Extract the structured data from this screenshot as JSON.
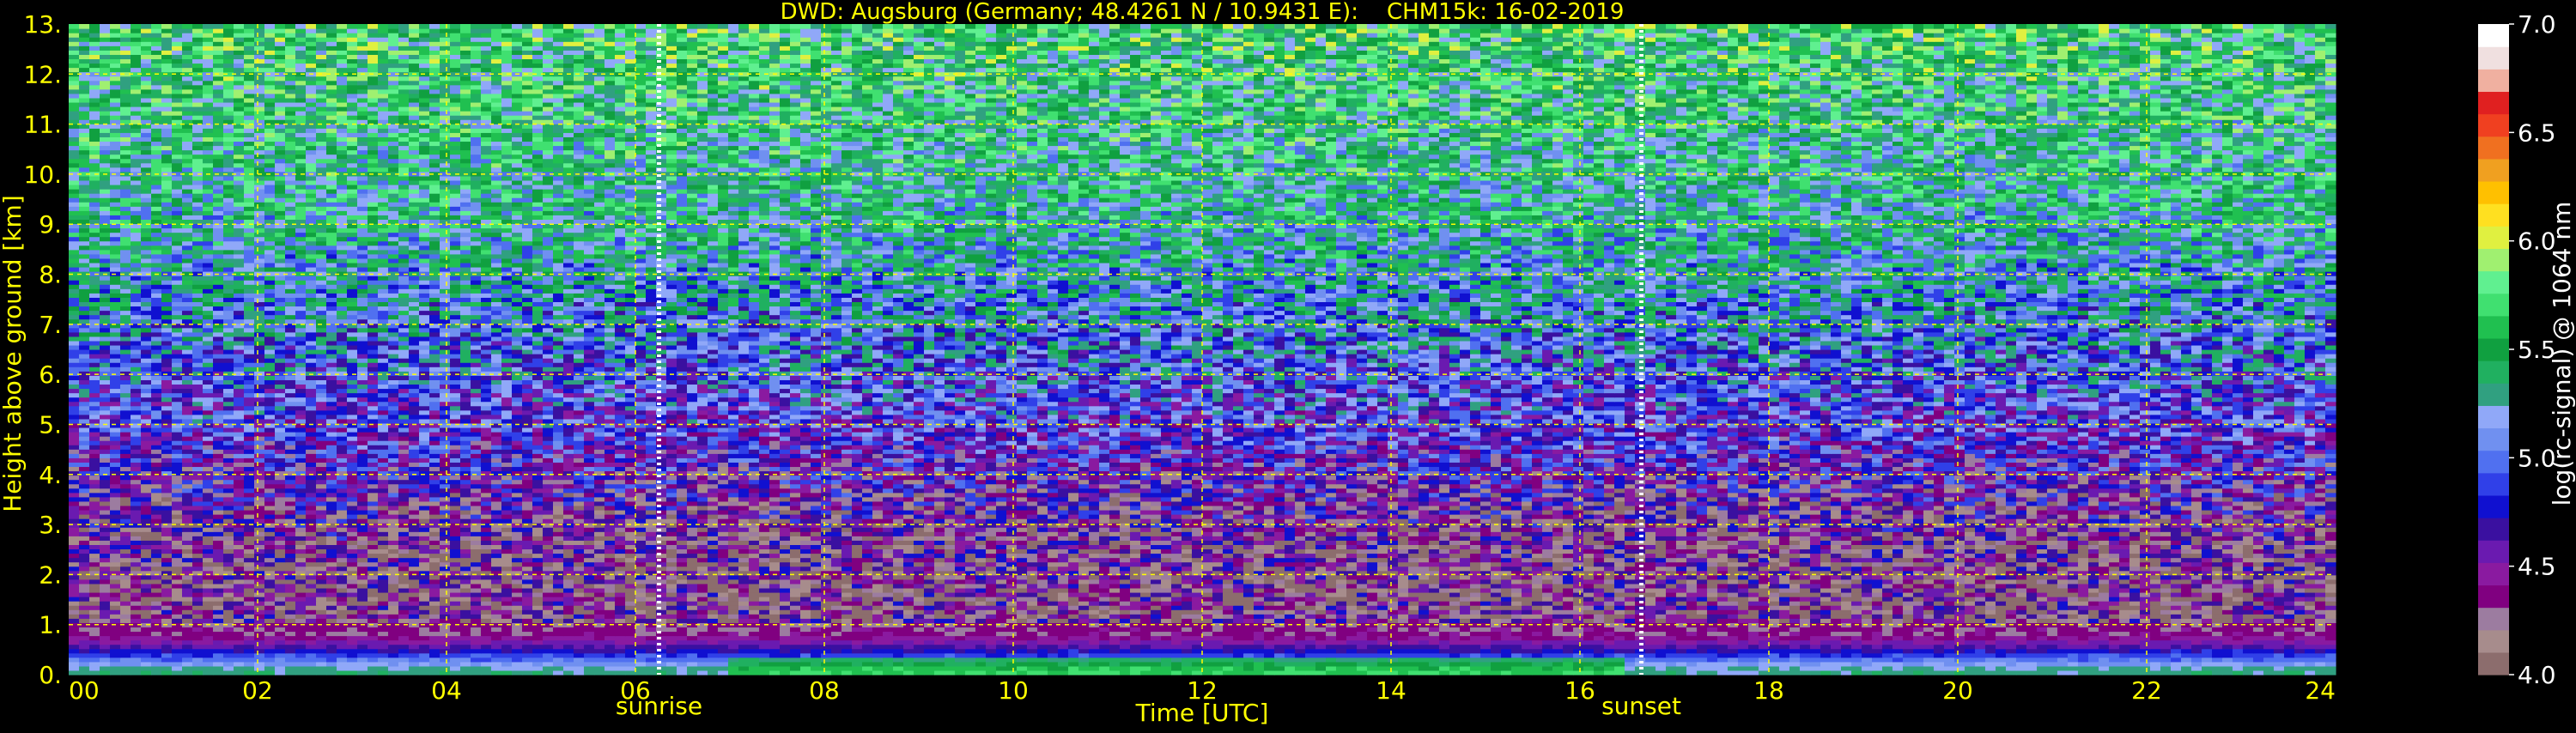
{
  "chart_data": {
    "type": "heatmap",
    "title": "DWD: Augsburg (Germany; 48.4261 N / 10.9431 E):    CHM15k: 16-02-2019",
    "xlabel": "Time [UTC]",
    "ylabel": "Height above ground [km]",
    "xlim": [
      0,
      24
    ],
    "ylim": [
      0,
      13
    ],
    "x_ticks": [
      "00",
      "02",
      "04",
      "06",
      "08",
      "10",
      "12",
      "14",
      "16",
      "18",
      "20",
      "22",
      "24"
    ],
    "y_ticks": [
      "0.",
      "1.",
      "2.",
      "3.",
      "4.",
      "5.",
      "6.",
      "7.",
      "8.",
      "9.",
      "10.",
      "11.",
      "12.",
      "13."
    ],
    "grid": true,
    "grid_color": "#ffff00",
    "text_color": "#ffff00",
    "background": "#000000",
    "markers": [
      {
        "label": "sunrise",
        "time_utc": 6.25
      },
      {
        "label": "sunset",
        "time_utc": 16.65
      }
    ],
    "colorbar": {
      "label": "log(rc-signal) @ 1064 nm",
      "range": [
        4.0,
        7.0
      ],
      "ticks": [
        "4.0",
        "4.5",
        "5.0",
        "5.5",
        "6.0",
        "6.5",
        "7.0"
      ],
      "colors": [
        "#8c6d6d",
        "#a78c8c",
        "#9c7ca0",
        "#800080",
        "#8a1aa0",
        "#6a1ab0",
        "#3a10a0",
        "#1010d0",
        "#3040e8",
        "#5070f0",
        "#7090f0",
        "#90a8f8",
        "#30a080",
        "#20b060",
        "#10a040",
        "#20c050",
        "#40e070",
        "#60f090",
        "#a0f070",
        "#e0f040",
        "#ffe020",
        "#ffc000",
        "#f0a020",
        "#f07020",
        "#f04020",
        "#e02020",
        "#f0b0a0",
        "#f0e0e0",
        "#ffffff"
      ]
    },
    "profile": [
      {
        "h_km": 0.1,
        "log": 5.3
      },
      {
        "h_km": 0.3,
        "log": 5.0
      },
      {
        "h_km": 0.55,
        "log": 4.65
      },
      {
        "h_km": 0.8,
        "log": 4.35
      },
      {
        "h_km": 1.5,
        "log": 4.3
      },
      {
        "h_km": 3.0,
        "log": 4.4
      },
      {
        "h_km": 5.0,
        "log": 4.8
      },
      {
        "h_km": 7.0,
        "log": 5.1
      },
      {
        "h_km": 9.0,
        "log": 5.35
      },
      {
        "h_km": 13.0,
        "log": 5.6
      }
    ]
  }
}
